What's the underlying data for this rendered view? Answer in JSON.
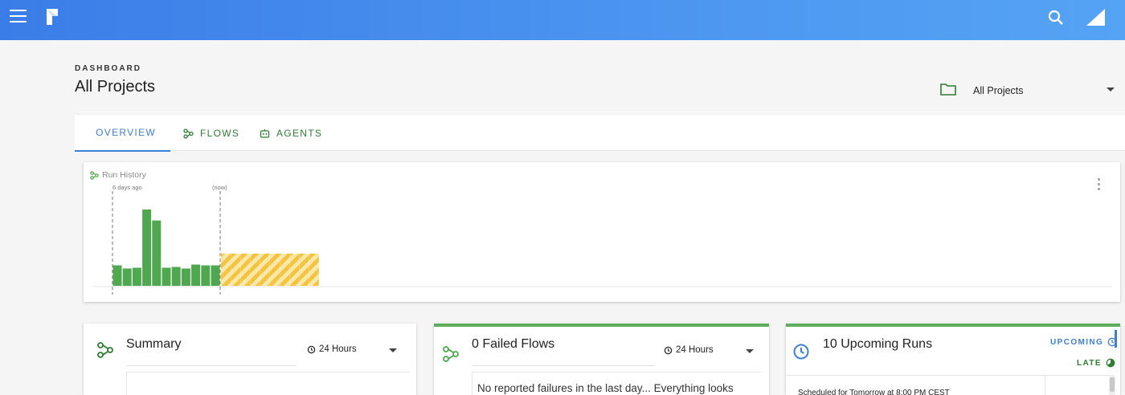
{
  "header": {
    "menu_icon": "menu-icon",
    "logo_icon": "prefect-logo-icon",
    "search_icon": "search-icon",
    "user_icon": "user-corner-icon",
    "background_color": "#4a8fee"
  },
  "page": {
    "eyebrow": "DASHBOARD",
    "title": "All Projects"
  },
  "project_select": {
    "icon": "folder-icon",
    "value": "All Projects"
  },
  "tabs": [
    {
      "label": "OVERVIEW",
      "icon": "dashboard-icon",
      "active": true
    },
    {
      "label": "FLOWS",
      "icon": "flow-icon",
      "active": false
    },
    {
      "label": "AGENTS",
      "icon": "agent-icon",
      "active": false
    }
  ],
  "run_history": {
    "title": "Run History",
    "start_label": "6 days ago",
    "now_label": "(now)"
  },
  "chart_data": {
    "type": "bar",
    "past_values": [
      26,
      22,
      23,
      97,
      83,
      23,
      24,
      22,
      27,
      26,
      26
    ],
    "upcoming_values": [
      41,
      41,
      41,
      41,
      41,
      41,
      41,
      41,
      41,
      41
    ],
    "past_color": "#4fa74f",
    "upcoming_color": "#f2c442"
  },
  "summary": {
    "icon": "flow-icon",
    "title": "Summary",
    "range": "24 Hours",
    "range_icon": "history-icon"
  },
  "failed": {
    "icon": "flow-icon",
    "title": "0 Failed Flows",
    "range": "24 Hours",
    "range_icon": "history-icon",
    "message": "No reported failures in the last day... Everything looks",
    "accent_color": "#5cae5c"
  },
  "upcoming": {
    "icon": "clock-icon",
    "title": "10 Upcoming Runs",
    "upcoming_label": "UPCOMING",
    "late_label": "LATE",
    "scheduled": "Scheduled for Tomorrow at 8:00 PM CEST",
    "accent_color": "#5cae5c",
    "upcoming_color": "#3d7fd9",
    "late_color": "#2e7d32"
  }
}
